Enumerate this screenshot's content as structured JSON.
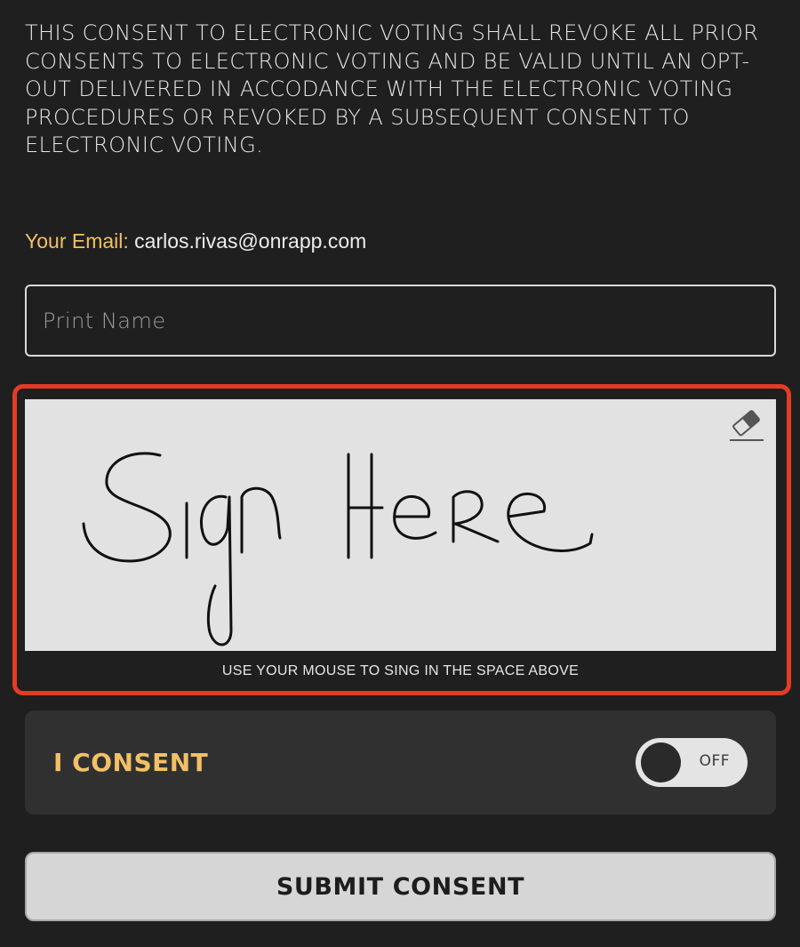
{
  "notice": {
    "text": "THIS CONSENT TO ELECTRONIC VOTING SHALL REVOKE ALL PRIOR CONSENTS TO ELECTRONIC VOTING AND BE VALID UNTIL AN OPT-OUT DELIVERED IN ACCODANCE WITH THE ELECTRONIC VOTING PROCEDURES OR REVOKED BY A SUBSEQUENT CONSENT TO ELECTRONIC VOTING."
  },
  "email": {
    "label": "Your Email:",
    "value": "carlos.rivas@onrapp.com"
  },
  "name_field": {
    "placeholder": "Print Name",
    "value": ""
  },
  "signature": {
    "drawn_text": "Sign Here",
    "caption": "USE YOUR MOUSE TO SING IN THE SPACE ABOVE",
    "clear_icon": "eraser-icon",
    "highlight_color": "#e43b26"
  },
  "consent": {
    "label": "I CONSENT",
    "toggle_state": "OFF"
  },
  "submit": {
    "label": "SUBMIT CONSENT"
  },
  "colors": {
    "background": "#1f1f1f",
    "accent": "#f2c066",
    "panel": "#303030",
    "signature_pad": "#e2e2e2"
  }
}
